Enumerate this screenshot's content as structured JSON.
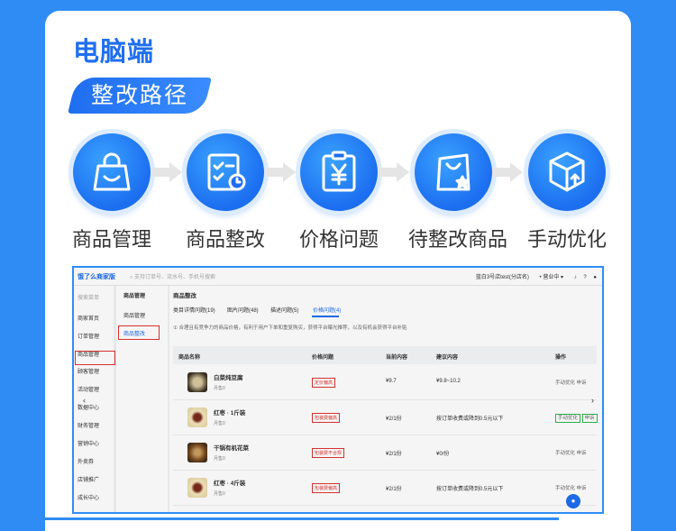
{
  "heading": "电脑端",
  "tag": "整改路径",
  "steps": [
    {
      "label": "商品管理",
      "icon": "shopping-bag-icon"
    },
    {
      "label": "商品整改",
      "icon": "checklist-clock-icon"
    },
    {
      "label": "价格问题",
      "icon": "yen-clipboard-icon"
    },
    {
      "label": "待整改商品",
      "icon": "star-bag-icon"
    },
    {
      "label": "手动优化",
      "icon": "box-upload-icon"
    }
  ],
  "app": {
    "logo": "饿了么商家版",
    "search_placeholder": "支持订单号、流水号、手机号搜索",
    "store": "蓝白3号店test(分店名)",
    "status": "营业中",
    "left_nav": [
      "搜索菜单",
      "商家首页",
      "订单管理",
      "商品管理",
      "顾客管理",
      "活动管理",
      "数据中心",
      "财务管理",
      "营销中心",
      "外卖券",
      "店铺推广",
      "成长中心"
    ],
    "sub_nav": [
      "商品管理",
      "商品整改"
    ],
    "breadcrumb": "商品整改",
    "tabs": [
      "类目详情问题(19)",
      "图片问题(48)",
      "描述问题(5)",
      "价格问题(4)"
    ],
    "notice": "① 合理且有竞争力的商品价格，有利于用户下单和重复购买，获得平台曝光推荐，以及有机会获得平台补贴",
    "columns": [
      "商品名称",
      "价格问题",
      "当前内容",
      "建议内容",
      "操作"
    ],
    "rows": [
      {
        "name": "白菜炖豆腐",
        "sales": "月售0",
        "issue": "定价偏高",
        "current": "¥9.7",
        "suggest": "¥9.8~10.2",
        "ops": [
          "手动优化",
          "申诉"
        ],
        "boxed": false
      },
      {
        "name": "红枣 · 1斤装",
        "sales": "月售0",
        "issue": "包装费偏高",
        "current": "¥2/1份",
        "suggest": "按订单收费或降到0.5元以下",
        "ops": [
          "手动优化",
          "申诉"
        ],
        "boxed": true
      },
      {
        "name": "干锅有机花菜",
        "sales": "月售0",
        "issue": "包装费不合规",
        "current": "¥2/1份",
        "suggest": "¥0/份",
        "ops": [
          "手动优化",
          "申诉"
        ],
        "boxed": false
      },
      {
        "name": "红枣 · 4斤装",
        "sales": "月售0",
        "issue": "包装费偏高",
        "current": "¥2/1份",
        "suggest": "按订单收费或降到0.5元以下",
        "ops": [
          "手动优化",
          "申诉"
        ],
        "boxed": false
      }
    ]
  },
  "colors": {
    "brand": "#1f6ef0",
    "background": "#2f8cf5",
    "highlight": "#e0342f",
    "green": "#2db84c"
  }
}
